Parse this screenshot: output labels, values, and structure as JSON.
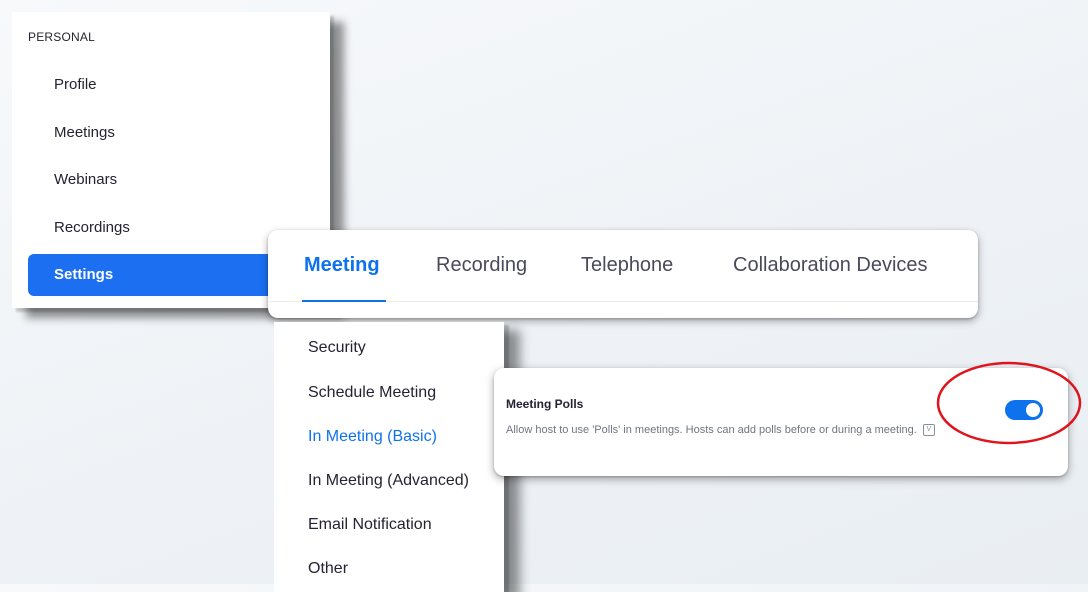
{
  "sidebar": {
    "section_label": "PERSONAL",
    "items": [
      {
        "label": "Profile"
      },
      {
        "label": "Meetings"
      },
      {
        "label": "Webinars"
      },
      {
        "label": "Recordings"
      },
      {
        "label": "Settings",
        "active": true
      }
    ]
  },
  "tabs": [
    {
      "label": "Meeting",
      "active": true
    },
    {
      "label": "Recording"
    },
    {
      "label": "Telephone"
    },
    {
      "label": "Collaboration Devices"
    }
  ],
  "submenu": {
    "items": [
      {
        "label": "Security"
      },
      {
        "label": "Schedule Meeting"
      },
      {
        "label": "In Meeting (Basic)",
        "active": true
      },
      {
        "label": "In Meeting (Advanced)"
      },
      {
        "label": "Email Notification"
      },
      {
        "label": "Other"
      }
    ]
  },
  "setting": {
    "title": "Meeting Polls",
    "description": "Allow host to use 'Polls' in meetings. Hosts can add polls before or during a meeting.",
    "info_icon": "V",
    "toggle_on": true
  },
  "colors": {
    "accent": "#0e72ed",
    "sidebar_active_bg": "#1b6ff0",
    "highlight_ring": "#e0141c",
    "text": "#232333",
    "muted_text": "#6e7680"
  },
  "icons": {
    "info": "info-icon",
    "toggle": "toggle-switch"
  }
}
